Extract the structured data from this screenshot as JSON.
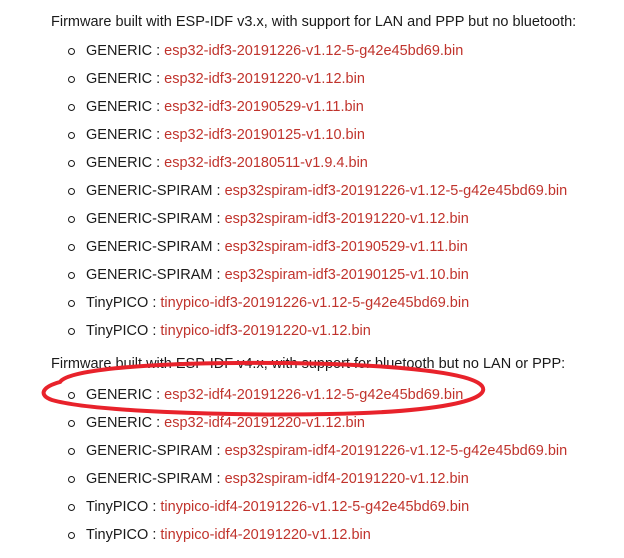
{
  "sections": [
    {
      "heading": "Firmware built with ESP-IDF v3.x, with support for LAN and PPP but no bluetooth:",
      "items": [
        {
          "board": "GENERIC",
          "file": "esp32-idf3-20191226-v1.12-5-g42e45bd69.bin"
        },
        {
          "board": "GENERIC",
          "file": "esp32-idf3-20191220-v1.12.bin"
        },
        {
          "board": "GENERIC",
          "file": "esp32-idf3-20190529-v1.11.bin"
        },
        {
          "board": "GENERIC",
          "file": "esp32-idf3-20190125-v1.10.bin"
        },
        {
          "board": "GENERIC",
          "file": "esp32-idf3-20180511-v1.9.4.bin"
        },
        {
          "board": "GENERIC-SPIRAM",
          "file": "esp32spiram-idf3-20191226-v1.12-5-g42e45bd69.bin"
        },
        {
          "board": "GENERIC-SPIRAM",
          "file": "esp32spiram-idf3-20191220-v1.12.bin"
        },
        {
          "board": "GENERIC-SPIRAM",
          "file": "esp32spiram-idf3-20190529-v1.11.bin"
        },
        {
          "board": "GENERIC-SPIRAM",
          "file": "esp32spiram-idf3-20190125-v1.10.bin"
        },
        {
          "board": "TinyPICO",
          "file": "tinypico-idf3-20191226-v1.12-5-g42e45bd69.bin"
        },
        {
          "board": "TinyPICO",
          "file": "tinypico-idf3-20191220-v1.12.bin"
        }
      ]
    },
    {
      "heading": "Firmware built with ESP-IDF v4.x, with support for bluetooth but no LAN or PPP:",
      "items": [
        {
          "board": "GENERIC",
          "file": "esp32-idf4-20191226-v1.12-5-g42e45bd69.bin"
        },
        {
          "board": "GENERIC",
          "file": "esp32-idf4-20191220-v1.12.bin"
        },
        {
          "board": "GENERIC-SPIRAM",
          "file": "esp32spiram-idf4-20191226-v1.12-5-g42e45bd69.bin"
        },
        {
          "board": "GENERIC-SPIRAM",
          "file": "esp32spiram-idf4-20191220-v1.12.bin"
        },
        {
          "board": "TinyPICO",
          "file": "tinypico-idf4-20191226-v1.12-5-g42e45bd69.bin"
        },
        {
          "board": "TinyPICO",
          "file": "tinypico-idf4-20191220-v1.12.bin"
        }
      ]
    }
  ],
  "separator": " : ",
  "colors": {
    "text": "#1a1a1a",
    "link": "#c0332c",
    "highlight": "#e8222b"
  },
  "highlight": {
    "shape": "hand-drawn-ellipse",
    "target_section": 1,
    "target_item": 0
  }
}
